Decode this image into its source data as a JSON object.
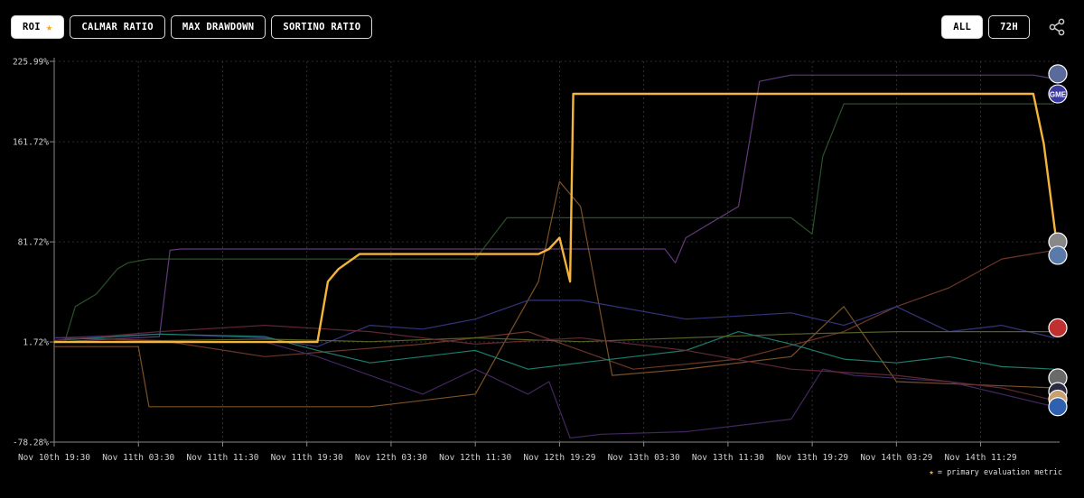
{
  "tabs": [
    {
      "label": "ROI",
      "active": true,
      "starred": true
    },
    {
      "label": "CALMAR RATIO",
      "active": false
    },
    {
      "label": "MAX DRAWDOWN",
      "active": false
    },
    {
      "label": "SORTINO RATIO",
      "active": false
    }
  ],
  "time_range": {
    "options": [
      "ALL",
      "72H"
    ],
    "selected": "ALL"
  },
  "share_icon": "share-icon",
  "footnote": {
    "star": "★",
    "text": "= primary evaluation metric"
  },
  "colors": {
    "primary": "#f5b43c",
    "star": "#f5a623",
    "grid": "#3a3a3a",
    "axis": "#cfcfcf"
  },
  "chart_data": {
    "type": "line",
    "title": "",
    "xlabel": "",
    "ylabel": "",
    "y_ticks": [
      "225.99%",
      "161.72%",
      "81.72%",
      "1.72%",
      "-78.28%"
    ],
    "y_tick_values": [
      225.99,
      161.72,
      81.72,
      1.72,
      -78.28
    ],
    "ylim": [
      -78.28,
      225.99
    ],
    "x_ticks": [
      "Nov 10th 19:30",
      "Nov 11th 03:30",
      "Nov 11th 11:30",
      "Nov 11th 19:30",
      "Nov 12th 03:30",
      "Nov 12th 11:30",
      "Nov 12th 19:29",
      "Nov 13th 03:30",
      "Nov 13th 11:30",
      "Nov 13th 19:29",
      "Nov 14th 03:29",
      "Nov 14th 11:29"
    ],
    "x_tick_hours": [
      0,
      8,
      16,
      24,
      32,
      40,
      48,
      56,
      64,
      72,
      80,
      88
    ],
    "xlim_hours": [
      0,
      95.5
    ],
    "grid": true,
    "series": [
      {
        "color": "#f5b43c",
        "primary": true,
        "width": 2.4,
        "points": [
          [
            0,
            1.7
          ],
          [
            25,
            1.7
          ],
          [
            26,
            50
          ],
          [
            27,
            60
          ],
          [
            29,
            72
          ],
          [
            46,
            72
          ],
          [
            47,
            76
          ],
          [
            48,
            85
          ],
          [
            49,
            50
          ],
          [
            49.3,
            200
          ],
          [
            70,
            200
          ],
          [
            93,
            200
          ],
          [
            94,
            160
          ],
          [
            95.2,
            81.7
          ]
        ]
      },
      {
        "color": "#6b3f8a",
        "width": 1.2,
        "points": [
          [
            0,
            1.7
          ],
          [
            10,
            6
          ],
          [
            11,
            75
          ],
          [
            12,
            76
          ],
          [
            58,
            76
          ],
          [
            59,
            65
          ],
          [
            60,
            85
          ],
          [
            63,
            100
          ],
          [
            65,
            110
          ],
          [
            66,
            160
          ],
          [
            67,
            210
          ],
          [
            70,
            215
          ],
          [
            93,
            215
          ],
          [
            95,
            212
          ]
        ]
      },
      {
        "color": "#2e5a2e",
        "width": 1.2,
        "points": [
          [
            0,
            1.7
          ],
          [
            1,
            2
          ],
          [
            2,
            30
          ],
          [
            4,
            40
          ],
          [
            6,
            60
          ],
          [
            7,
            65
          ],
          [
            9,
            68
          ],
          [
            40,
            68
          ],
          [
            43,
            101
          ],
          [
            70,
            101
          ],
          [
            72,
            88
          ],
          [
            73,
            150
          ],
          [
            75,
            192
          ],
          [
            95,
            192
          ]
        ]
      },
      {
        "color": "#7a3c2a",
        "width": 1.2,
        "points": [
          [
            0,
            5
          ],
          [
            10,
            3
          ],
          [
            20,
            -10
          ],
          [
            35,
            0
          ],
          [
            45,
            10
          ],
          [
            55,
            -20
          ],
          [
            65,
            -12
          ],
          [
            75,
            10
          ],
          [
            80,
            30
          ],
          [
            85,
            45
          ],
          [
            90,
            68
          ],
          [
            95,
            75
          ]
        ]
      },
      {
        "color": "#8a5a2a",
        "width": 1.2,
        "points": [
          [
            0,
            -2
          ],
          [
            8,
            -2
          ],
          [
            9,
            -50
          ],
          [
            30,
            -50
          ],
          [
            40,
            -40
          ],
          [
            42,
            -10
          ],
          [
            44,
            20
          ],
          [
            46,
            50
          ],
          [
            48,
            130
          ],
          [
            50,
            110
          ],
          [
            52,
            20
          ],
          [
            53,
            -25
          ],
          [
            60,
            -20
          ],
          [
            70,
            -10
          ],
          [
            75,
            30
          ],
          [
            80,
            -30
          ],
          [
            95,
            -35
          ]
        ]
      },
      {
        "color": "#3a3a8a",
        "width": 1.2,
        "points": [
          [
            0,
            5
          ],
          [
            10,
            8
          ],
          [
            20,
            5
          ],
          [
            25,
            -2
          ],
          [
            30,
            15
          ],
          [
            35,
            12
          ],
          [
            40,
            20
          ],
          [
            45,
            35
          ],
          [
            50,
            35
          ],
          [
            60,
            20
          ],
          [
            70,
            25
          ],
          [
            75,
            15
          ],
          [
            80,
            30
          ],
          [
            85,
            10
          ],
          [
            90,
            15
          ],
          [
            95,
            5
          ]
        ]
      },
      {
        "color": "#1f8a7a",
        "width": 1.2,
        "points": [
          [
            0,
            3
          ],
          [
            10,
            8
          ],
          [
            20,
            6
          ],
          [
            25,
            -5
          ],
          [
            30,
            -15
          ],
          [
            35,
            -10
          ],
          [
            40,
            -5
          ],
          [
            45,
            -20
          ],
          [
            50,
            -15
          ],
          [
            55,
            -10
          ],
          [
            60,
            -5
          ],
          [
            65,
            10
          ],
          [
            70,
            0
          ],
          [
            75,
            -12
          ],
          [
            80,
            -15
          ],
          [
            85,
            -10
          ],
          [
            90,
            -18
          ],
          [
            95,
            -20
          ]
        ]
      },
      {
        "color": "#4a2a6a",
        "width": 1.2,
        "points": [
          [
            0,
            1.7
          ],
          [
            20,
            1.7
          ],
          [
            25,
            -10
          ],
          [
            30,
            -25
          ],
          [
            35,
            -40
          ],
          [
            40,
            -20
          ],
          [
            45,
            -40
          ],
          [
            47,
            -30
          ],
          [
            49,
            -75
          ],
          [
            52,
            -72
          ],
          [
            60,
            -70
          ],
          [
            65,
            -65
          ],
          [
            70,
            -60
          ],
          [
            73,
            -20
          ],
          [
            76,
            -25
          ],
          [
            85,
            -30
          ],
          [
            95,
            -50
          ]
        ]
      },
      {
        "color": "#5c6a2a",
        "width": 1.2,
        "points": [
          [
            0,
            1.7
          ],
          [
            20,
            4
          ],
          [
            30,
            2
          ],
          [
            40,
            5
          ],
          [
            50,
            2
          ],
          [
            60,
            5
          ],
          [
            70,
            8
          ],
          [
            80,
            10
          ],
          [
            90,
            10
          ],
          [
            95,
            10
          ]
        ]
      },
      {
        "color": "#6a2a3a",
        "width": 1.2,
        "points": [
          [
            0,
            3
          ],
          [
            10,
            10
          ],
          [
            20,
            15
          ],
          [
            30,
            10
          ],
          [
            40,
            0
          ],
          [
            50,
            5
          ],
          [
            60,
            -5
          ],
          [
            70,
            -20
          ],
          [
            80,
            -25
          ],
          [
            90,
            -35
          ],
          [
            95,
            -45
          ]
        ]
      }
    ],
    "end_markers": [
      {
        "y": 216,
        "color": "#5a6a9a",
        "label": ""
      },
      {
        "y": 200,
        "color": "#3a3aa0",
        "label": "GME"
      },
      {
        "y": 81.7,
        "color": "#888",
        "label": ""
      },
      {
        "y": 71,
        "color": "#5a7aaa",
        "label": ""
      },
      {
        "y": 13,
        "color": "#c03030",
        "label": ""
      },
      {
        "y": -27,
        "color": "#6a6a6a",
        "label": ""
      },
      {
        "y": -38,
        "color": "#2a2a40",
        "label": ""
      },
      {
        "y": -44,
        "color": "#c8a070",
        "label": ""
      },
      {
        "y": -50,
        "color": "#3060b0",
        "label": ""
      }
    ]
  }
}
